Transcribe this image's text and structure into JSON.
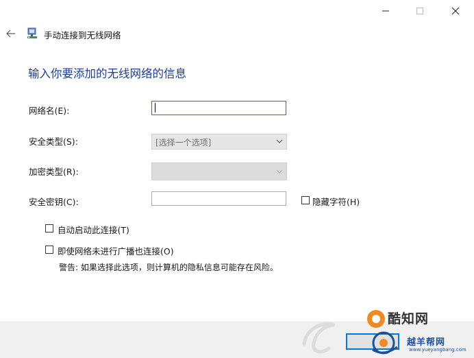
{
  "window": {
    "title": "手动连接到无线网络"
  },
  "page": {
    "heading": "输入你要添加的无线网络的信息"
  },
  "form": {
    "network_name_label": "网络名(E):",
    "network_name_value": "",
    "security_type_label": "安全类型(S):",
    "security_type_value": "[选择一个选项]",
    "encryption_type_label": "加密类型(R):",
    "encryption_type_value": "",
    "security_key_label": "安全密钥(C):",
    "security_key_value": "",
    "hide_chars_label": "隐藏字符(H)",
    "hide_chars_checked": false,
    "auto_connect_label": "自动启动此连接(T)",
    "auto_connect_checked": false,
    "connect_hidden_label": "即使网络未进行广播也连接(O)",
    "connect_hidden_checked": false,
    "warning_text": "警告: 如果选择此选项，则计算机的隐私信息可能存在风险。"
  },
  "watermark": {
    "brand": "酷知网",
    "site_name": "越羊帮网",
    "site_url": "www.yueyangbang.com"
  },
  "icons": {
    "back": "back-arrow-icon",
    "network": "network-wizard-icon",
    "minimize": "minimize-icon",
    "maximize": "maximize-icon",
    "close": "close-icon",
    "dropdown": "chevron-down-icon"
  },
  "colors": {
    "heading": "#1e3d8f",
    "focus_border": "#0078d7",
    "disabled_field": "#e6e6e6",
    "footer": "#f0f0f0"
  }
}
